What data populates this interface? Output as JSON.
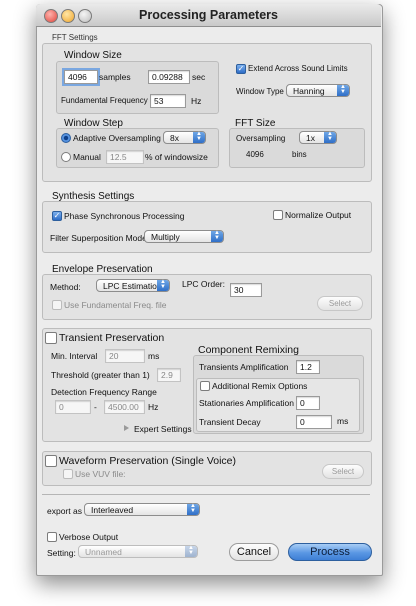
{
  "window": {
    "title": "Processing Parameters"
  },
  "fft": {
    "group_label": "FFT Settings",
    "window_size": {
      "title": "Window Size",
      "samples_value": "4096",
      "samples_unit": "samples",
      "sec_value": "0.09288",
      "sec_unit": "sec",
      "fund_freq_label": "Fundamental Frequency",
      "fund_freq_value": "53",
      "fund_freq_unit": "Hz"
    },
    "extend_label": "Extend Across Sound Limits",
    "window_type_label": "Window Type",
    "window_type_value": "Hanning",
    "window_step": {
      "title": "Window Step",
      "adaptive_label": "Adaptive Oversampling",
      "adaptive_value": "8x",
      "manual_label": "Manual",
      "manual_value": "12.5",
      "manual_unit": "% of windowsize"
    },
    "fft_size": {
      "title": "FFT Size",
      "oversampling_label": "Oversampling",
      "oversampling_value": "1x",
      "bins_value": "4096",
      "bins_unit": "bins"
    }
  },
  "synthesis": {
    "title": "Synthesis Settings",
    "phase_label": "Phase Synchronous Processing",
    "normalize_label": "Normalize Output",
    "filter_label": "Filter Superposition Mode",
    "filter_value": "Multiply"
  },
  "envelope": {
    "title": "Envelope Preservation",
    "method_label": "Method:",
    "method_value": "LPC Estimation",
    "lpc_label": "LPC Order:",
    "lpc_value": "30",
    "use_fund_label": "Use Fundamental Freq. file",
    "select_label": "Select"
  },
  "transient": {
    "title": "Transient Preservation",
    "min_interval_label": "Min. Interval",
    "min_interval_value": "20",
    "min_interval_unit": "ms",
    "threshold_label": "Threshold (greater than 1)",
    "threshold_value": "2.9",
    "detect_label": "Detection Frequency Range",
    "detect_low": "0",
    "detect_sep": "-",
    "detect_high": "4500.00",
    "detect_unit": "Hz",
    "expert_label": "Expert Settings"
  },
  "remix": {
    "title": "Component Remixing",
    "transients_label": "Transients Amplification",
    "transients_value": "1.2",
    "additional_label": "Additional Remix Options",
    "stationaries_label": "Stationaries Amplification",
    "stationaries_value": "0",
    "decay_label": "Transient Decay",
    "decay_value": "0",
    "decay_unit": "ms"
  },
  "waveform": {
    "title": "Waveform Preservation (Single Voice)",
    "use_vuv_label": "Use VUV file:",
    "select_label": "Select"
  },
  "export": {
    "label": "export as",
    "value": "Interleaved"
  },
  "verbose_label": "Verbose Output",
  "setting": {
    "label": "Setting:",
    "value": "Unnamed"
  },
  "buttons": {
    "cancel": "Cancel",
    "process": "Process"
  },
  "colors": {
    "accent": "#3a78d0",
    "window_bg": "#ececec",
    "group_bg": "#e3e3e3"
  },
  "states": {
    "extend_checked": true,
    "adaptive_selected": true,
    "phase_checked": true,
    "normalize_checked": false,
    "transient_checked": false,
    "additional_checked": false,
    "waveform_checked": false,
    "verbose_checked": false
  }
}
